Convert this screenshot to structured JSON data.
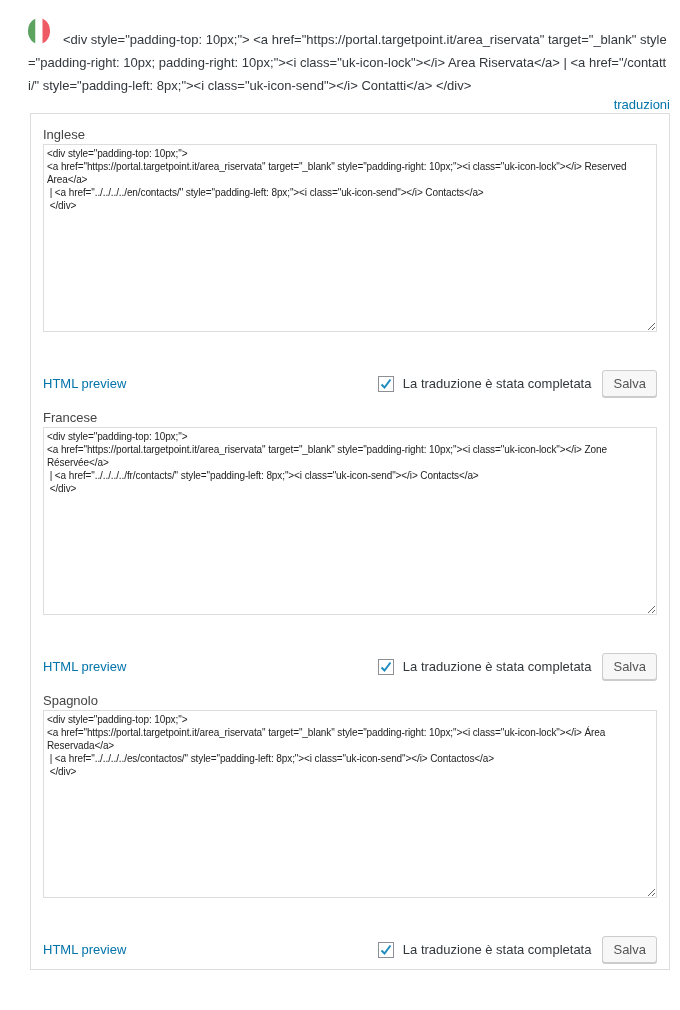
{
  "header": {
    "source_html": "<div style=\"padding-top: 10px;\"> <a href=\"https://portal.targetpoint.it/area_riservata\" target=\"_blank\" style=\"padding-right: 10px; padding-right: 10px;\"><i class=\"uk-icon-lock\"></i> Area Riservata</a> | <a href=\"/contatti/\" style=\"padding-left: 8px;\"><i class=\"uk-icon-send\"></i> Contatti</a> </div>",
    "link": "traduzioni"
  },
  "translations": [
    {
      "language": "Inglese",
      "text": "<div style=\"padding-top: 10px;\">\n<a href=\"https://portal.targetpoint.it/area_riservata\" target=\"_blank\" style=\"padding-right: 10px;\"><i class=\"uk-icon-lock\"></i> Reserved Area</a>\n | <a href=\"../../../../en/contacts/\" style=\"padding-left: 8px;\"><i class=\"uk-icon-send\"></i> Contacts</a>\n </div>",
      "preview_link": "HTML preview",
      "completed": true,
      "completed_label": "La traduzione è stata completata",
      "save_button": "Salva"
    },
    {
      "language": "Francese",
      "text": "<div style=\"padding-top: 10px;\">\n<a href=\"https://portal.targetpoint.it/area_riservata\" target=\"_blank\" style=\"padding-right: 10px;\"><i class=\"uk-icon-lock\"></i> Zone Réservée</a>\n | <a href=\"../../../../fr/contacts/\" style=\"padding-left: 8px;\"><i class=\"uk-icon-send\"></i> Contacts</a>\n </div>",
      "preview_link": "HTML preview",
      "completed": true,
      "completed_label": "La traduzione è stata completata",
      "save_button": "Salva"
    },
    {
      "language": "Spagnolo",
      "text": "<div style=\"padding-top: 10px;\">\n<a href=\"https://portal.targetpoint.it/area_riservata\" target=\"_blank\" style=\"padding-right: 10px;\"><i class=\"uk-icon-lock\"></i> Área Reservada</a>\n | <a href=\"../../../../es/contactos/\" style=\"padding-left: 8px;\"><i class=\"uk-icon-send\"></i> Contactos</a>\n </div>",
      "preview_link": "HTML preview",
      "completed": true,
      "completed_label": "La traduzione è stata completata",
      "save_button": "Salva"
    }
  ]
}
